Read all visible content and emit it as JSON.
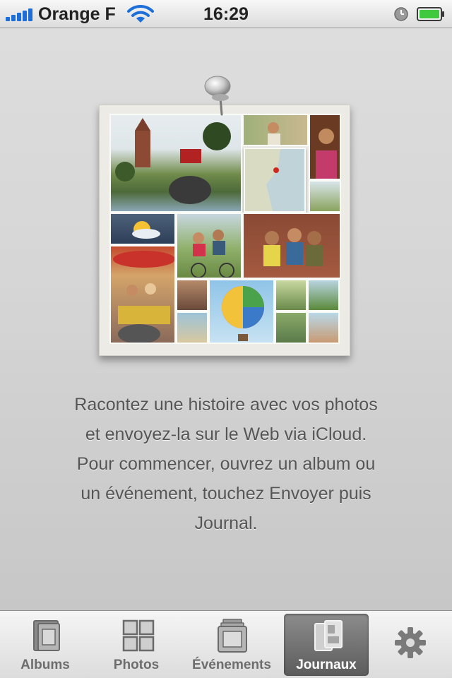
{
  "status_bar": {
    "carrier": "Orange F",
    "time": "16:29",
    "icons": [
      "signal-bars-icon",
      "wifi-icon",
      "alarm-clock-icon",
      "battery-icon"
    ],
    "signal_bars": 5,
    "battery_level": 1.0,
    "battery_color": "#3ec93e"
  },
  "main": {
    "illustration": {
      "icon": "pinned-photo-collage",
      "pin_icon": "pushpin-icon"
    },
    "description": "Racontez une histoire avec vos photos et envoyez-la sur le Web via iCloud. Pour commencer, ouvrez un album ou un événement, touchez Envoyer puis Journal."
  },
  "tabbar": {
    "tabs": [
      {
        "label": "Albums",
        "icon": "albums-icon",
        "active": false
      },
      {
        "label": "Photos",
        "icon": "photos-grid-icon",
        "active": false
      },
      {
        "label": "Événements",
        "icon": "events-icon",
        "active": false
      },
      {
        "label": "Journaux",
        "icon": "journals-icon",
        "active": true
      },
      {
        "label": "",
        "icon": "gear-icon",
        "active": false
      }
    ]
  },
  "colors": {
    "background": "#d6d6d6",
    "text": "#555555",
    "active_tab": "#6e6e6e",
    "signal_blue": "#1c6fd9"
  }
}
